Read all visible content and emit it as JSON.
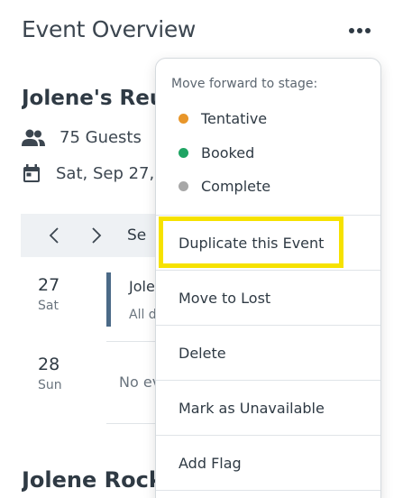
{
  "header": {
    "title": "Event Overview",
    "more_icon": "ellipsis-horizontal-icon"
  },
  "event": {
    "title": "Jolene's Reu",
    "guests_icon": "people-icon",
    "guests": "75 Guests",
    "date_icon": "calendar-icon",
    "date": "Sat, Sep 27,"
  },
  "calendar": {
    "nav_label": "Se",
    "days": [
      {
        "num": "27",
        "dow": "Sat"
      },
      {
        "num": "28",
        "dow": "Sun"
      }
    ],
    "event": {
      "title": "Jole",
      "sub": "All d"
    },
    "empty_text": "No ev"
  },
  "section_title": "Jolene Rock",
  "menu": {
    "heading": "Move forward to stage:",
    "stages": [
      {
        "label": "Tentative",
        "color": "#e8962a"
      },
      {
        "label": "Booked",
        "color": "#1fa463"
      },
      {
        "label": "Complete",
        "color": "#a7a7a7"
      }
    ],
    "actions": {
      "duplicate": "Duplicate this Event",
      "lost": "Move to Lost",
      "delete": "Delete",
      "unavailable": "Mark as Unavailable",
      "flag": "Add Flag"
    },
    "highlight_color": "#f6e200"
  }
}
